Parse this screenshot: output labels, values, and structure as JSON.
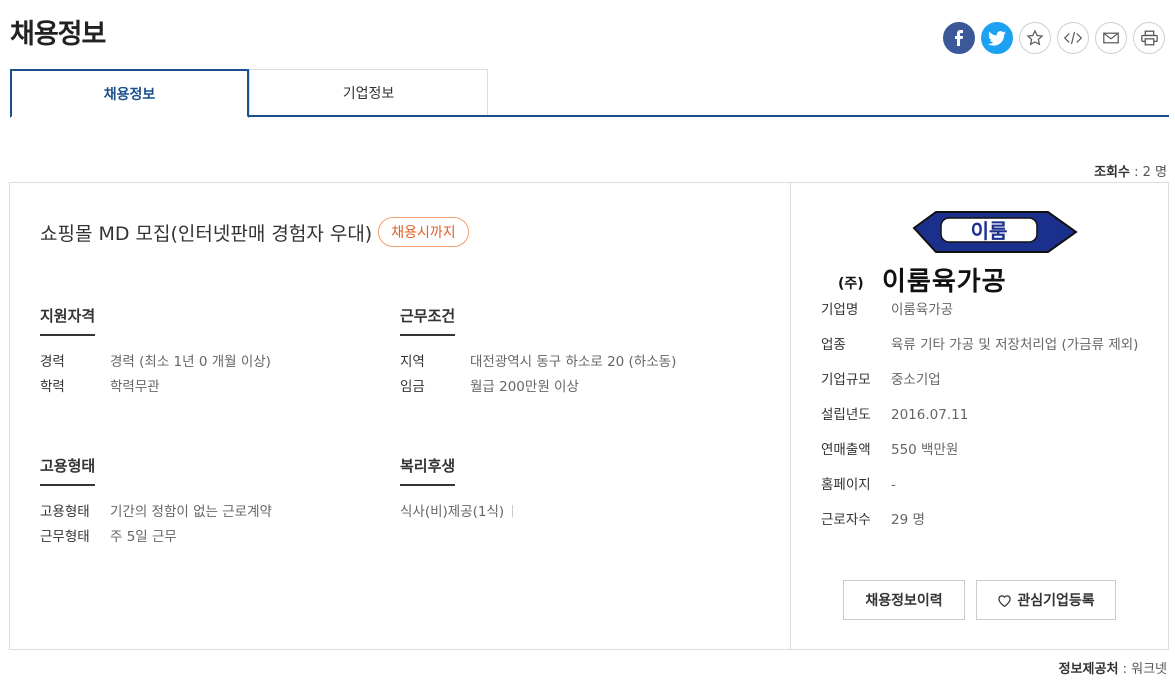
{
  "page": {
    "title": "채용정보"
  },
  "share": {
    "icons": [
      "facebook-icon",
      "twitter-icon",
      "star-icon",
      "embed-icon",
      "mail-icon",
      "print-icon"
    ],
    "colors": {
      "facebook": "#3b5998",
      "twitter": "#1da1f2"
    }
  },
  "tabs": [
    {
      "label": "채용정보",
      "active": true
    },
    {
      "label": "기업정보",
      "active": false
    }
  ],
  "view_count": {
    "label": "조회수",
    "value": ": 2 명"
  },
  "job": {
    "title": "쇼핑몰 MD 모집(인터넷판매 경험자 우대)",
    "badge": "채용시까지",
    "qualifications": {
      "title": "지원자격",
      "rows": [
        {
          "key": "경력",
          "value": "경력 (최소 1년 0 개월 이상)"
        },
        {
          "key": "학력",
          "value": "학력무관"
        }
      ]
    },
    "conditions": {
      "title": "근무조건",
      "rows": [
        {
          "key": "지역",
          "value": "대전광역시 동구 하소로 20 (하소동)"
        },
        {
          "key": "임금",
          "value": "월급 200만원 이상"
        }
      ]
    },
    "employment": {
      "title": "고용형태",
      "rows": [
        {
          "key": "고용형태",
          "value": "기간의 정함이 없는 근로계약"
        },
        {
          "key": "근무형태",
          "value": "주 5일 근무"
        }
      ]
    },
    "welfare": {
      "title": "복리후생",
      "items": [
        "식사(비)제공(1식)"
      ]
    }
  },
  "company": {
    "logo": {
      "prefix": "(주)",
      "name": "이룸육가공",
      "badge": "이룸"
    },
    "info": [
      {
        "key": "기업명",
        "value": "이룸육가공"
      },
      {
        "key": "업종",
        "value": "육류 기타 가공 및 저장처리업 (가금류 제외)"
      },
      {
        "key": "기업규모",
        "value": "중소기업"
      },
      {
        "key": "설립년도",
        "value": "2016.07.11"
      },
      {
        "key": "연매출액",
        "value": "550 백만원"
      },
      {
        "key": "홈페이지",
        "value": "-"
      },
      {
        "key": "근로자수",
        "value": "29 명"
      }
    ],
    "buttons": {
      "history": "채용정보이력",
      "favorite": "관심기업등록"
    }
  },
  "provider": {
    "label": "정보제공처",
    "value": ": 워크넷"
  }
}
